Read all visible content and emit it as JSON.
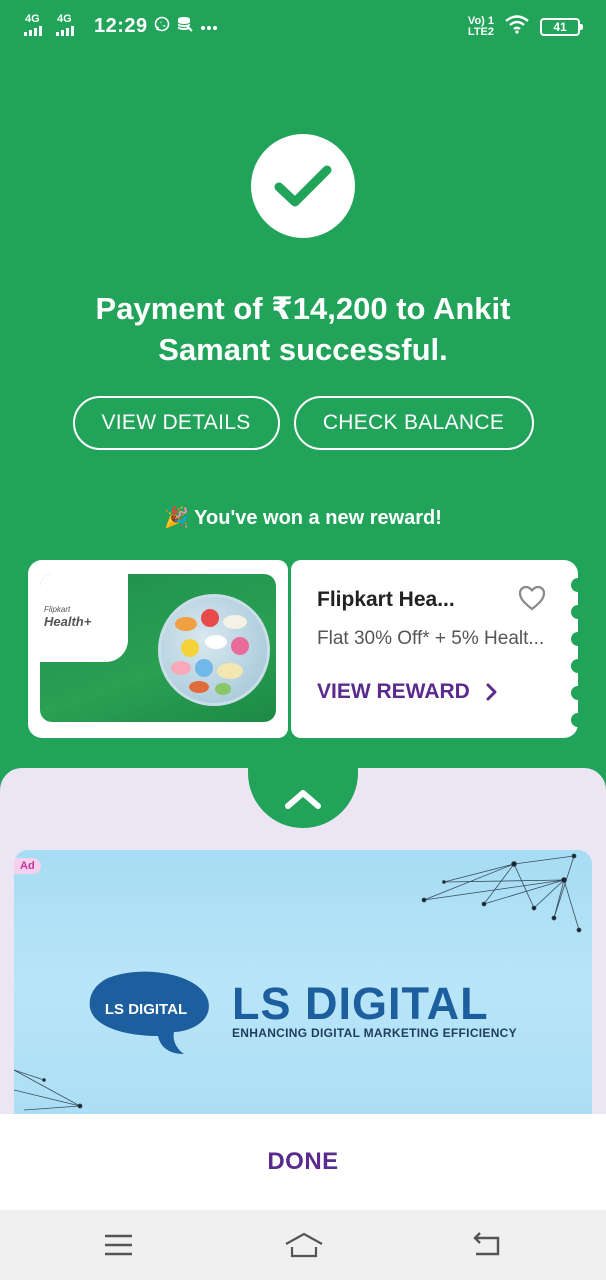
{
  "status_bar": {
    "net1": "4G",
    "net2": "4G",
    "time": "12:29",
    "icons": [
      "whatsapp-icon",
      "storage-icon",
      "more-dots-icon"
    ],
    "volte_line1": "Vo) 1",
    "volte_line2": "LTE2",
    "battery": "41"
  },
  "success": {
    "icon": "checkmark-icon",
    "message": "Payment of ₹14,200 to Ankit Samant successful.",
    "view_details_label": "VIEW DETAILS",
    "check_balance_label": "CHECK BALANCE"
  },
  "reward": {
    "banner_text": "🎉 You've won a new reward!",
    "brand_small": "Flipkart",
    "brand_name": "Health+",
    "title": "Flipkart Hea...",
    "subtitle": "Flat 30% Off* + 5% Healt...",
    "cta_label": "VIEW REWARD"
  },
  "ad": {
    "badge": "Ad",
    "logo_text": "LS DIGITAL",
    "title": "LS DIGITAL",
    "tagline": "ENHANCING DIGITAL MARKETING EFFICIENCY"
  },
  "footer": {
    "done_label": "DONE"
  },
  "colors": {
    "green": "#22a35a",
    "purple": "#5a2a8c",
    "lavender": "#ece5f4"
  }
}
